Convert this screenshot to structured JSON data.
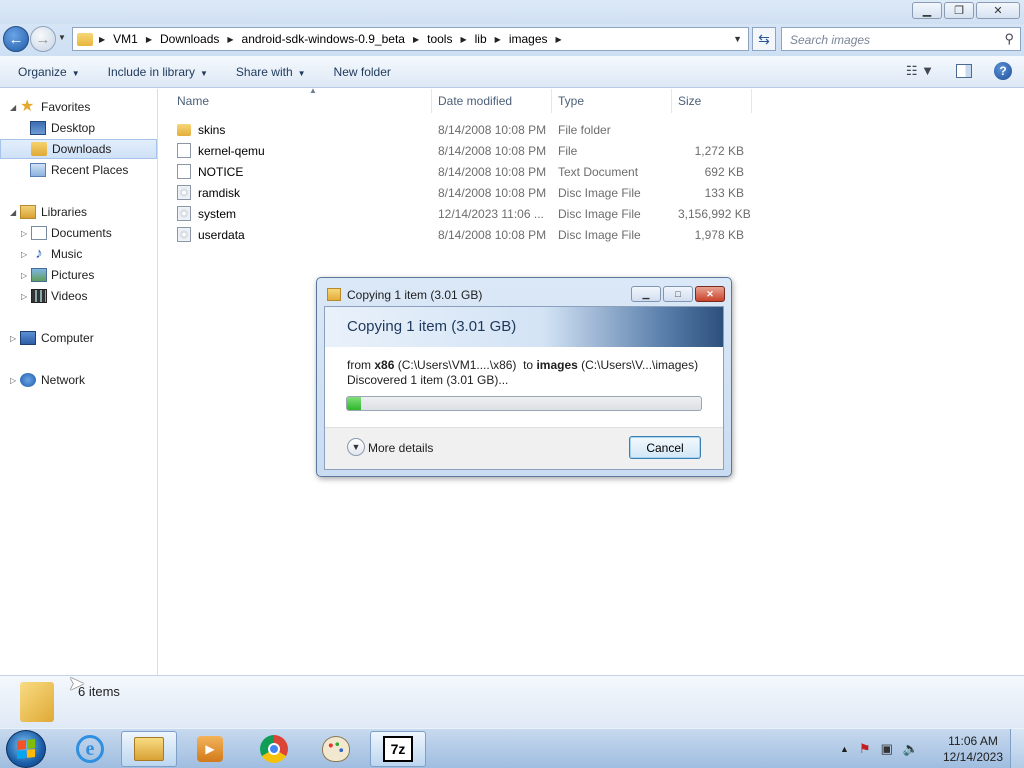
{
  "window": {
    "minimize_icon": "minimize-icon",
    "maximize_icon": "restore-icon",
    "close_icon": "close-icon"
  },
  "address": {
    "crumbs": [
      "VM1",
      "Downloads",
      "android-sdk-windows-0.9_beta",
      "tools",
      "lib",
      "images"
    ],
    "search_placeholder": "Search images"
  },
  "toolbar": {
    "organize": "Organize",
    "include_in_library": "Include in library",
    "share_with": "Share with",
    "new_folder": "New folder"
  },
  "navpane": {
    "favorites": "Favorites",
    "desktop": "Desktop",
    "downloads": "Downloads",
    "recent_places": "Recent Places",
    "libraries": "Libraries",
    "documents": "Documents",
    "music": "Music",
    "pictures": "Pictures",
    "videos": "Videos",
    "computer": "Computer",
    "network": "Network"
  },
  "filelist": {
    "columns": {
      "name": "Name",
      "date": "Date modified",
      "type": "Type",
      "size": "Size"
    },
    "rows": [
      {
        "name": "skins",
        "date": "8/14/2008 10:08 PM",
        "type": "File folder",
        "size": "",
        "icon": "folder-icon"
      },
      {
        "name": "kernel-qemu",
        "date": "8/14/2008 10:08 PM",
        "type": "File",
        "size": "1,272 KB",
        "icon": "file-icon"
      },
      {
        "name": "NOTICE",
        "date": "8/14/2008 10:08 PM",
        "type": "Text Document",
        "size": "692 KB",
        "icon": "file-icon"
      },
      {
        "name": "ramdisk",
        "date": "8/14/2008 10:08 PM",
        "type": "Disc Image File",
        "size": "133 KB",
        "icon": "disc-image-icon"
      },
      {
        "name": "system",
        "date": "12/14/2023 11:06 ...",
        "type": "Disc Image File",
        "size": "3,156,992 KB",
        "icon": "disc-image-icon"
      },
      {
        "name": "userdata",
        "date": "8/14/2008 10:08 PM",
        "type": "Disc Image File",
        "size": "1,978 KB",
        "icon": "disc-image-icon"
      }
    ]
  },
  "details": {
    "count": "6 items"
  },
  "dialog": {
    "title": "Copying 1 item (3.01 GB)",
    "header": "Copying 1 item (3.01 GB)",
    "from_prefix": "from",
    "from_name": "x86",
    "from_path": "(C:\\Users\\VM1....\\x86)",
    "to_prefix": "to",
    "to_name": "images",
    "to_path": "(C:\\Users\\V...\\images)",
    "status": "Discovered 1 item (3.01 GB)...",
    "progress_percent": 4,
    "more_details": "More details",
    "cancel": "Cancel"
  },
  "taskbar": {
    "apps": [
      "internet-explorer",
      "windows-explorer",
      "media-player",
      "chrome",
      "paint",
      "7-zip"
    ],
    "app_7z_label": "7z",
    "time": "11:06 AM",
    "date": "12/14/2023"
  }
}
